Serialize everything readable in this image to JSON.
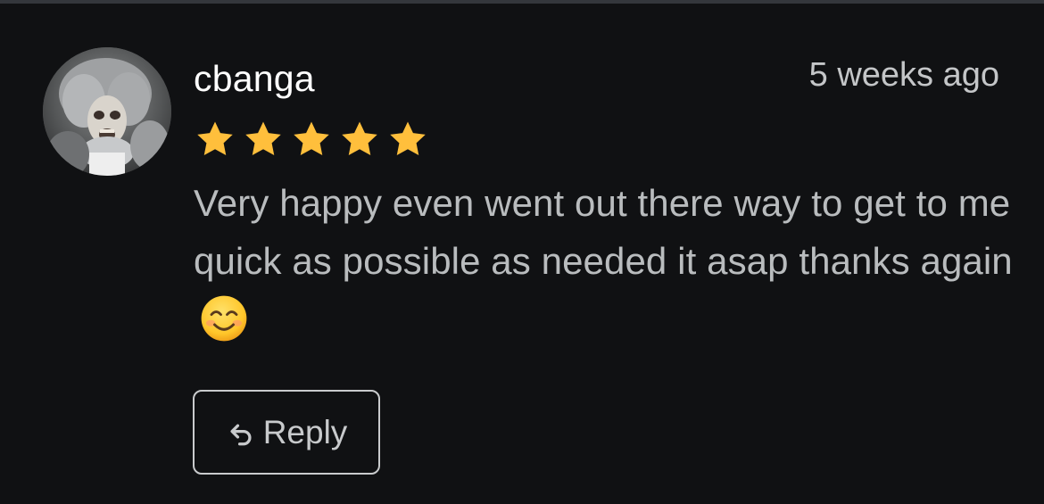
{
  "review": {
    "username": "cbanga",
    "timestamp": "5 weeks ago",
    "rating": 5,
    "rating_max": 5,
    "text": "Very happy even went out there way to get to me quick as possible as needed it asap thanks again",
    "emoji": "smiling-face-emoji"
  },
  "actions": {
    "reply_label": "Reply",
    "reply_icon": "reply-arrow-icon"
  },
  "colors": {
    "background": "#101113",
    "star": "#ffbf3c",
    "username": "#ffffff",
    "body_text": "#b9bcbe",
    "timestamp": "#c4c6c8",
    "button_border": "#c9cbcd"
  }
}
